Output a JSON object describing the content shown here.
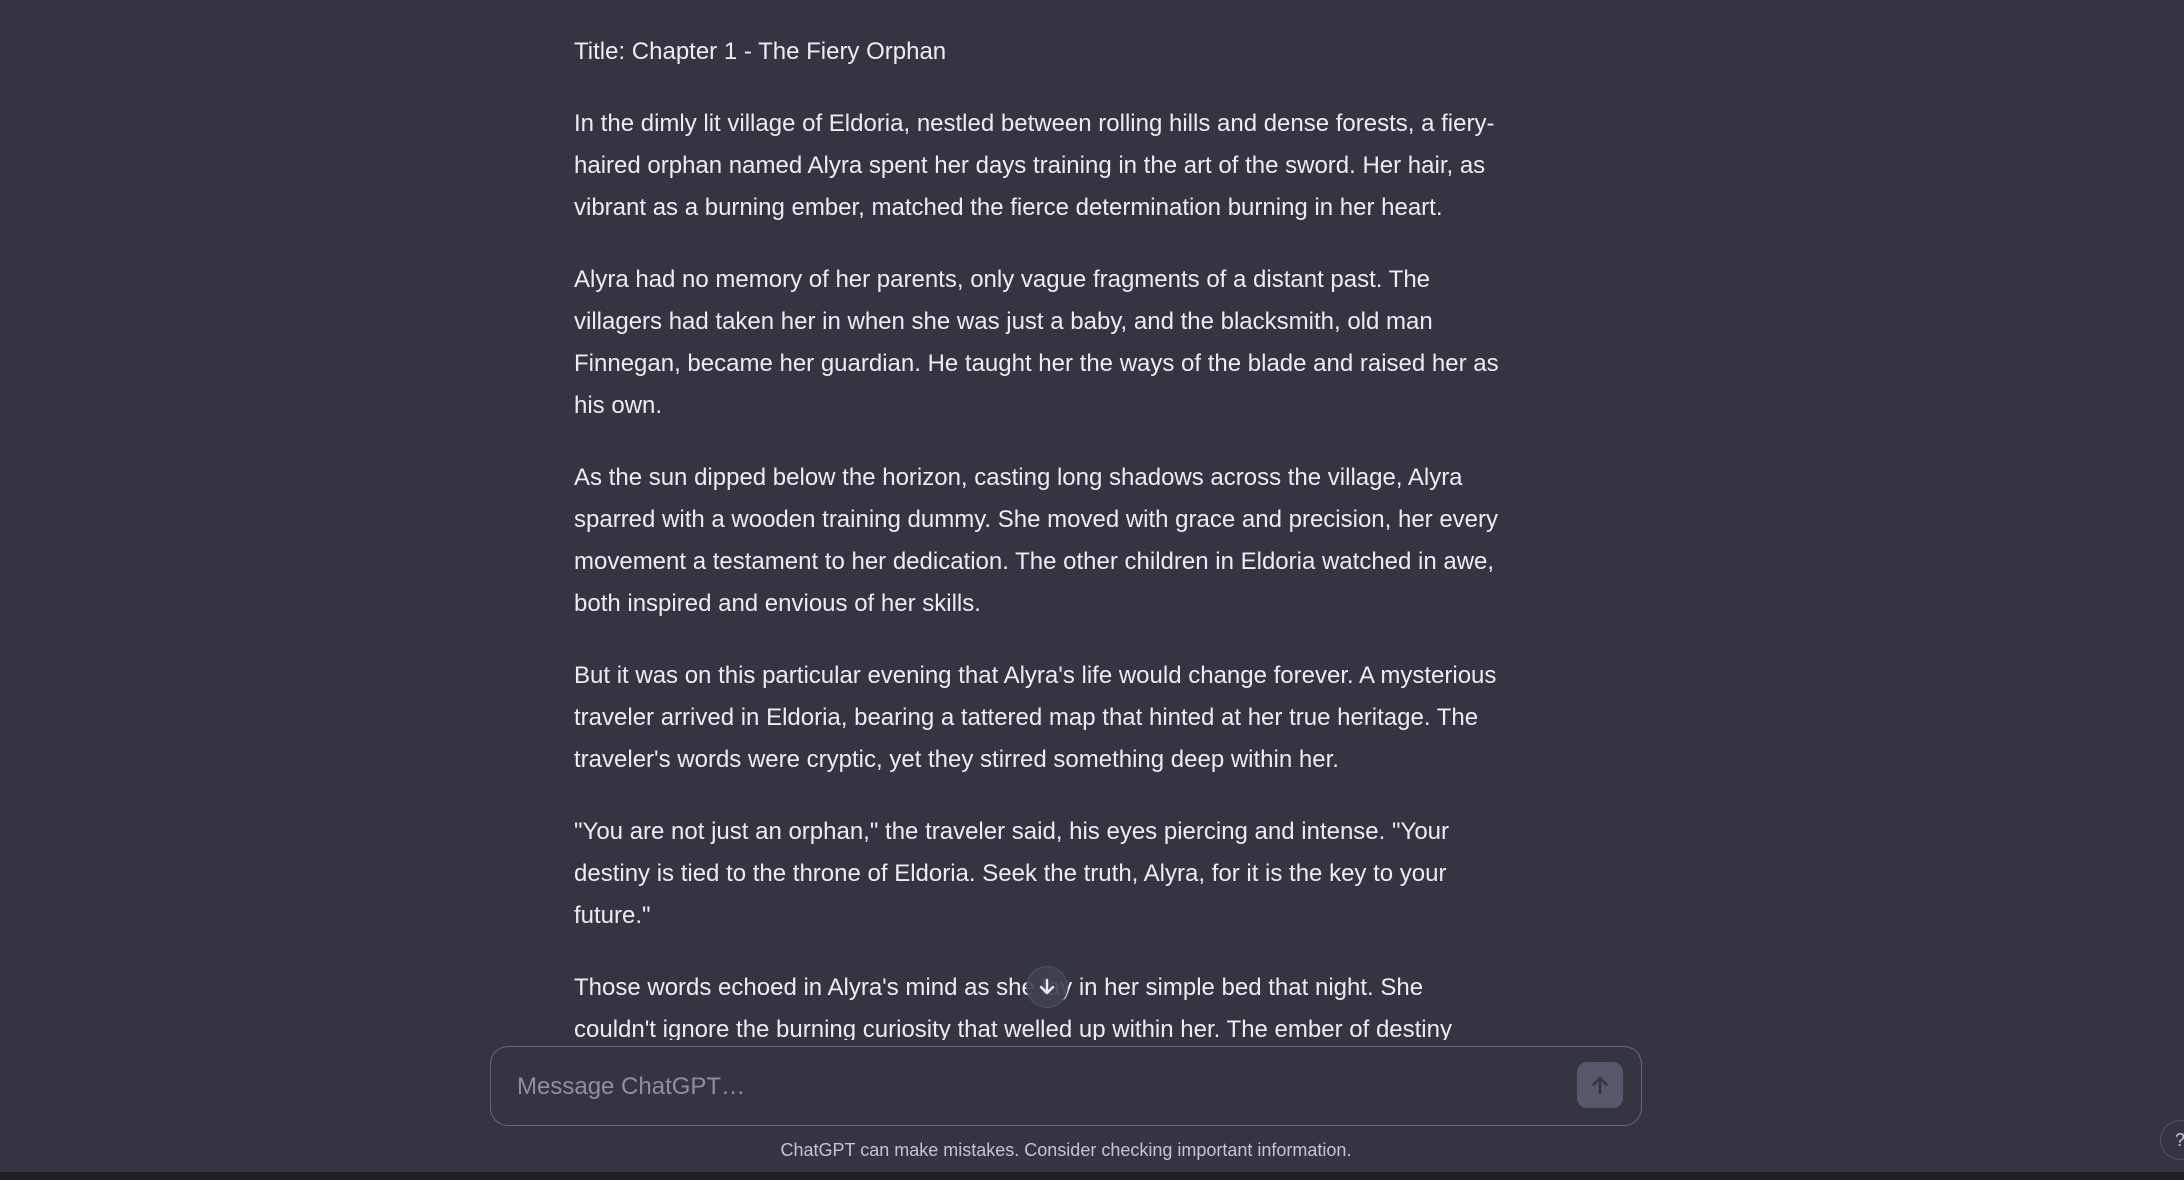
{
  "conversation": {
    "title": "Title: Chapter 1 - The Fiery Orphan",
    "paragraphs": [
      "In the dimly lit village of Eldoria, nestled between rolling hills and dense forests, a fiery-haired orphan named Alyra spent her days training in the art of the sword. Her hair, as vibrant as a burning ember, matched the fierce determination burning in her heart.",
      "Alyra had no memory of her parents, only vague fragments of a distant past. The villagers had taken her in when she was just a baby, and the blacksmith, old man Finnegan, became her guardian. He taught her the ways of the blade and raised her as his own.",
      "As the sun dipped below the horizon, casting long shadows across the village, Alyra sparred with a wooden training dummy. She moved with grace and precision, her every movement a testament to her dedication. The other children in Eldoria watched in awe, both inspired and envious of her skills.",
      "But it was on this particular evening that Alyra's life would change forever. A mysterious traveler arrived in Eldoria, bearing a tattered map that hinted at her true heritage. The traveler's words were cryptic, yet they stirred something deep within her.",
      "\"You are not just an orphan,\" the traveler said, his eyes piercing and intense. \"Your destiny is tied to the throne of Eldoria. Seek the truth, Alyra, for it is the key to your future.\"",
      "Those words echoed in Alyra's mind as she lay in her simple bed that night. She couldn't ignore the burning curiosity that welled up within her. The ember of destiny"
    ]
  },
  "composer": {
    "placeholder": "Message ChatGPT…",
    "value": ""
  },
  "footer": {
    "disclaimer": "ChatGPT can make mistakes. Consider checking important information.",
    "help_label": "?"
  },
  "icons": {
    "scroll_down": "arrow-down-icon",
    "send": "arrow-up-icon"
  },
  "colors": {
    "background": "#343541",
    "text": "#ececf1",
    "muted": "#8e8ea0"
  }
}
